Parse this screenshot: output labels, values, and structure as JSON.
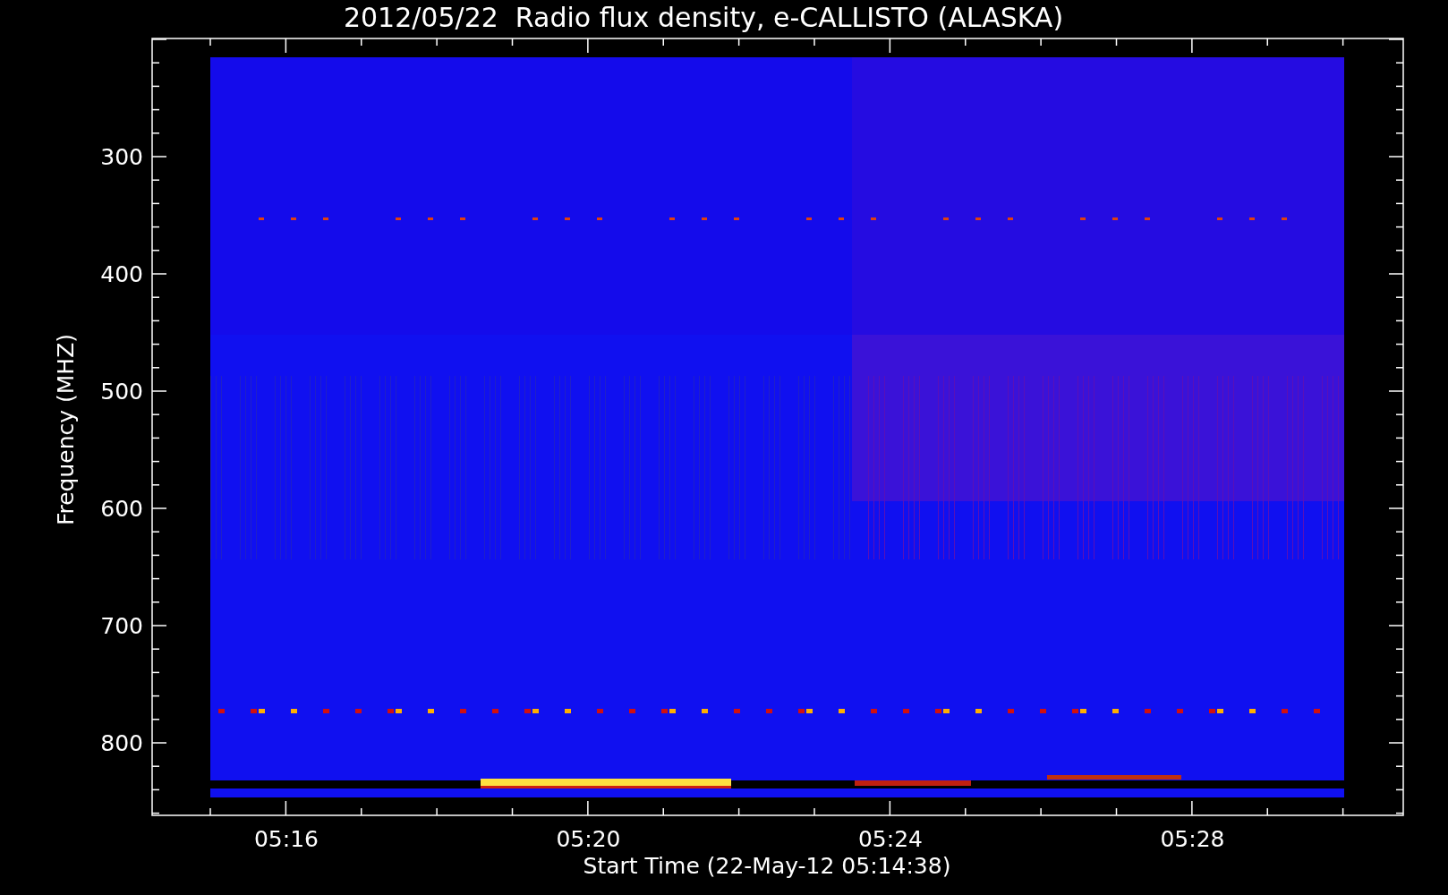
{
  "title": "2012/05/22  Radio flux density, e-CALLISTO (ALASKA)",
  "y_axis": {
    "label": "Frequency (MHZ)",
    "ticks": [
      "300",
      "400",
      "500",
      "600",
      "700",
      "800"
    ]
  },
  "x_axis": {
    "label": "Start Time (22-May-12 05:14:38)",
    "ticks": [
      "05:16",
      "05:20",
      "05:24",
      "05:28"
    ]
  }
}
